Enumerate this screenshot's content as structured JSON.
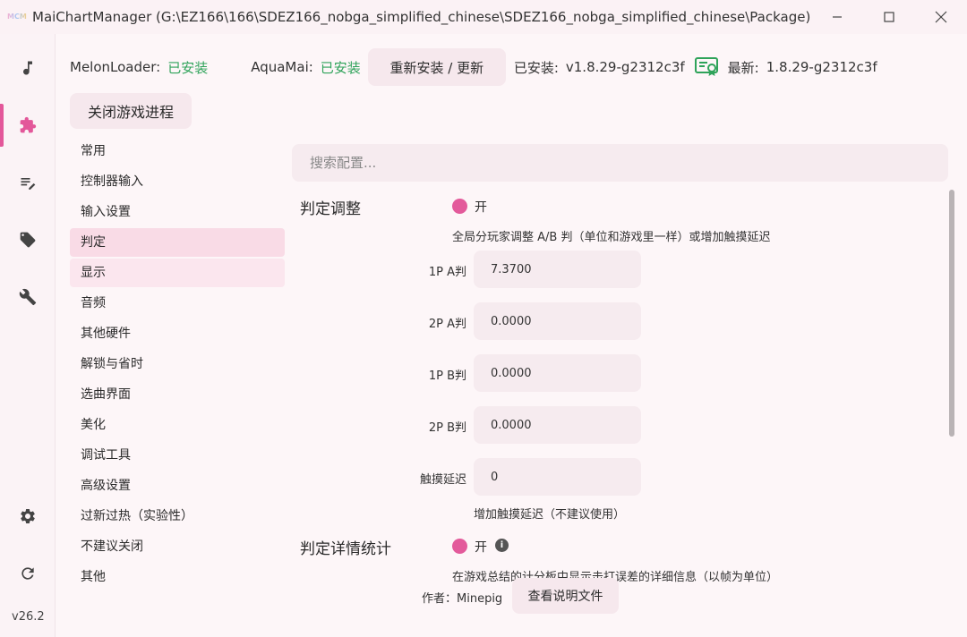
{
  "window": {
    "logo_text": "MCM",
    "title": "MaiChartManager (G:\\EZ166\\166\\SDEZ166_nobga_simplified_chinese\\SDEZ166_nobga_simplified_chinese\\Package)"
  },
  "rail": {
    "items": [
      {
        "icon": "music-note-icon"
      },
      {
        "icon": "puzzle-icon"
      },
      {
        "icon": "edit-list-icon"
      },
      {
        "icon": "tags-icon"
      },
      {
        "icon": "tools-icon"
      },
      {
        "icon": "gear-icon"
      },
      {
        "icon": "refresh-icon"
      }
    ],
    "active_index": 1,
    "version": "v26.2"
  },
  "status": {
    "melon_label": "MelonLoader:",
    "melon_state": "已安装",
    "aqua_label": "AquaMai:",
    "aqua_state": "已安装",
    "reinstall_label": "重新安装 / 更新",
    "installed_label": "已安装:",
    "installed_version": "v1.8.29-g2312c3f",
    "latest_label": "最新:",
    "latest_version": "1.8.29-g2312c3f"
  },
  "close_game_label": "关闭游戏进程",
  "categories": [
    "常用",
    "控制器输入",
    "输入设置",
    "判定",
    "显示",
    "音频",
    "其他硬件",
    "解锁与省时",
    "选曲界面",
    "美化",
    "调试工具",
    "高级设置",
    "过新过热（实验性）",
    "不建议关闭",
    "其他"
  ],
  "selected_category": "判定",
  "search": {
    "placeholder": "搜索配置..."
  },
  "sections": [
    {
      "title": "判定调整",
      "toggle_label": "开",
      "description": "全局分玩家调整 A/B 判（单位和游戏里一样）或增加触摸延迟",
      "fields": [
        {
          "label": "1P A判",
          "value": "7.3700"
        },
        {
          "label": "2P A判",
          "value": "0.0000"
        },
        {
          "label": "1P B判",
          "value": "0.0000"
        },
        {
          "label": "2P B判",
          "value": "0.0000"
        },
        {
          "label": "触摸延迟",
          "value": "0"
        }
      ],
      "field_hint": "增加触摸延迟（不建议使用）"
    },
    {
      "title": "判定详情统计",
      "toggle_label": "开",
      "description": "在游戏总结的计分板中显示击打误差的详细信息（以帧为单位）",
      "author_label": "作者：Minepig",
      "doc_button": "查看说明文件"
    }
  ],
  "colors": {
    "accent": "#e35a9b",
    "ok": "#2fa35a",
    "selected_bg": "#f9dbe6"
  }
}
